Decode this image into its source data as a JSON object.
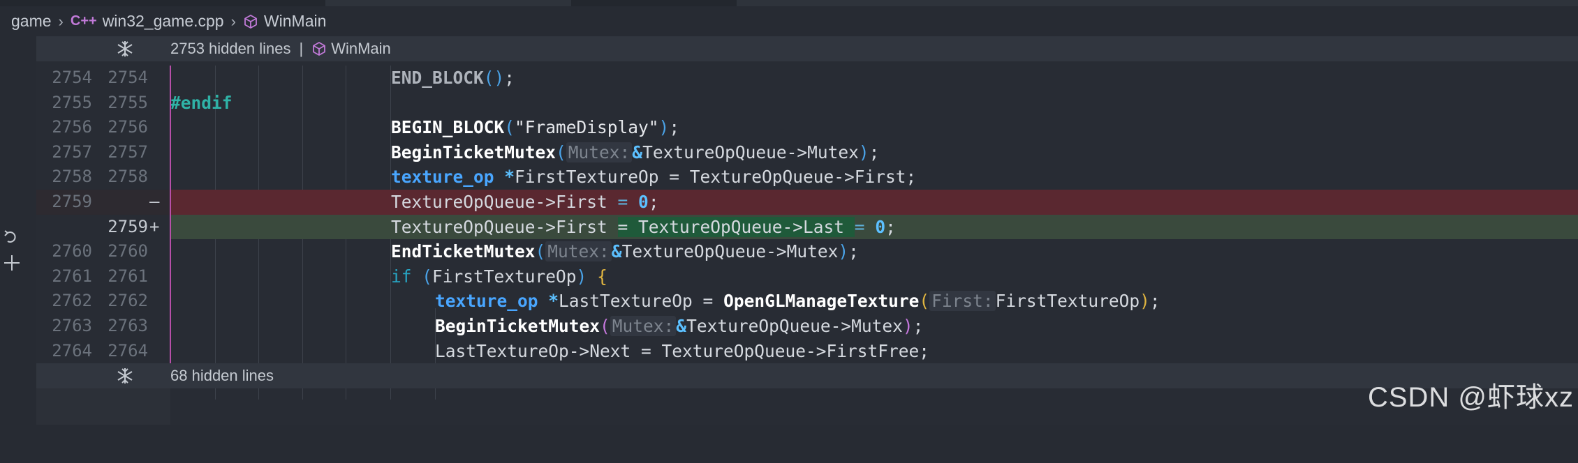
{
  "breadcrumb": {
    "folder": "game",
    "file": "win32_game.cpp",
    "file_icon_text": "C++",
    "symbol": "WinMain"
  },
  "top_hidden": {
    "text": "2753 hidden lines",
    "separator": "|",
    "symbol": "WinMain"
  },
  "bottom_hidden": {
    "text": "68 hidden lines"
  },
  "lines": [
    {
      "old": "2754",
      "new": "2754",
      "mark": ""
    },
    {
      "old": "2755",
      "new": "2755",
      "mark": ""
    },
    {
      "old": "2756",
      "new": "2756",
      "mark": ""
    },
    {
      "old": "2757",
      "new": "2757",
      "mark": ""
    },
    {
      "old": "2758",
      "new": "2758",
      "mark": ""
    },
    {
      "old": "2759",
      "new": "",
      "mark": "—"
    },
    {
      "old": "",
      "new": "2759",
      "mark": "+"
    },
    {
      "old": "2760",
      "new": "2760",
      "mark": ""
    },
    {
      "old": "2761",
      "new": "2761",
      "mark": ""
    },
    {
      "old": "2762",
      "new": "2762",
      "mark": ""
    },
    {
      "old": "2763",
      "new": "2763",
      "mark": ""
    },
    {
      "old": "2764",
      "new": "2764",
      "mark": ""
    }
  ],
  "code": {
    "l1": {
      "fn": "END_BLOCK",
      "p1": "(",
      "p2": ")",
      "end": ";"
    },
    "l2": {
      "pp": "#endif"
    },
    "l3": {
      "fn": "BEGIN_BLOCK",
      "p1": "(",
      "str": "\"FrameDisplay\"",
      "p2": ")",
      "end": ";"
    },
    "l4": {
      "fn": "BeginTicketMutex",
      "p1": "(",
      "hint": "Mutex:",
      "amp": "&",
      "arg": "TextureOpQueue->Mutex",
      "p2": ")",
      "end": ";"
    },
    "l5": {
      "type": "texture_op",
      "star": "*",
      "rest": "FirstTextureOp = TextureOpQueue->First;"
    },
    "l6": {
      "a": "TextureOpQueue->First ",
      "eq": "=",
      "sp": " ",
      "num": "0",
      "end": ";"
    },
    "l7": {
      "a": "TextureOpQueue->First ",
      "ins": "= TextureOpQueue->Last ",
      "eq": "=",
      "sp": " ",
      "num": "0",
      "end": ";"
    },
    "l8": {
      "fn": "EndTicketMutex",
      "p1": "(",
      "hint": "Mutex:",
      "amp": "&",
      "arg": "TextureOpQueue->Mutex",
      "p2": ")",
      "end": ";"
    },
    "l9": {
      "kw": "if",
      "p1": " (",
      "arg": "FirstTextureOp",
      "p2": ") ",
      "brace": "{"
    },
    "l10": {
      "type": "texture_op",
      "star": "*",
      "mid": "LastTextureOp = ",
      "fn": "OpenGLManageTexture",
      "p1": "(",
      "hint": "First:",
      "arg": "FirstTextureOp",
      "p2": ")",
      "end": ";"
    },
    "l11": {
      "fn": "BeginTicketMutex",
      "p1": "(",
      "hint": "Mutex:",
      "amp": "&",
      "arg": "TextureOpQueue->Mutex",
      "p2": ")",
      "end": ";"
    },
    "l12": {
      "text": "LastTextureOp->Next = TextureOpQueue->FirstFree;"
    }
  },
  "watermark": "CSDN @虾球xz",
  "icons": [
    "cpp-file-icon",
    "cube-icon",
    "fold-icon",
    "revert-icon",
    "plus-icon",
    "chevron-right-icon"
  ]
}
